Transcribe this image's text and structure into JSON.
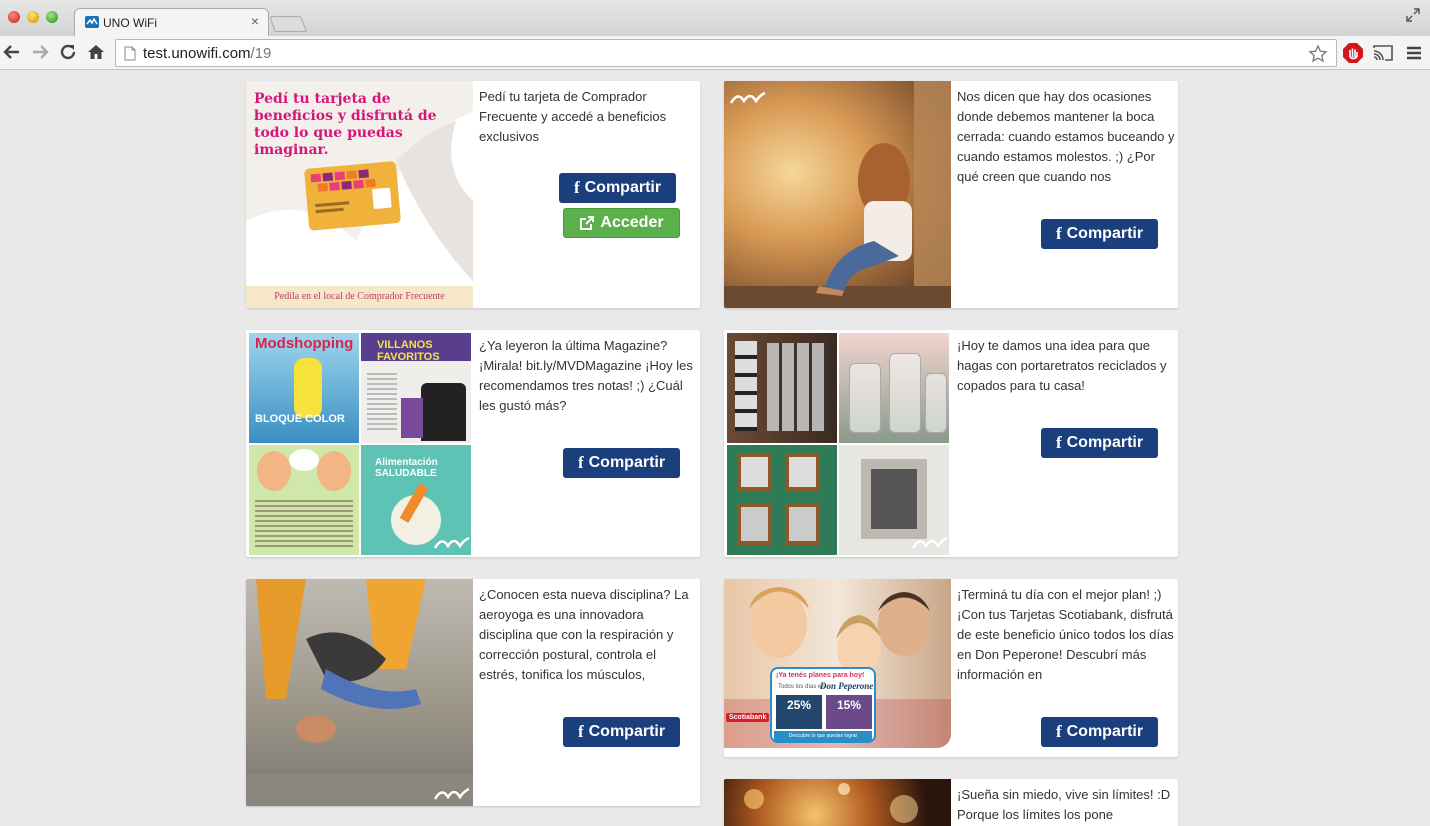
{
  "window": {
    "tab_title": "UNO WiFi",
    "tab_close": "×"
  },
  "toolbar": {
    "url_host": "test.unowifi.com",
    "url_path": "/19"
  },
  "buttons": {
    "share_label": "Compartir",
    "access_label": "Acceder",
    "fb_letter": "f"
  },
  "posts": [
    {
      "text": "Pedí tu tarjeta de Comprador Frecuente y accedé a beneficios exclusivos",
      "image_headline": "Pedí tu tarjeta de beneficios y disfrutá de todo lo que puedas imaginar.",
      "image_footer": "Pedila en el local de Comprador Frecuente"
    },
    {
      "text": "Nos dicen que hay dos ocasiones donde debemos mantener la boca cerrada: cuando estamos buceando y cuando estamos molestos. ;) ¿Por qué creen que cuando nos"
    },
    {
      "text": "¿Ya leyeron la última Magazine? ¡Mirala! bit.ly/MVDMagazine ¡Hoy les recomendamos tres notas! ;) ¿Cuál les gustó más?",
      "magazine_labels": [
        "Modshopping",
        "VILLANOS FAVORITOS",
        "BLOQUE COLOR",
        "Alimentación SALUDABLE"
      ]
    },
    {
      "text": "¡Hoy te damos una idea para que hagas con portaretratos reciclados y copados para tu casa!"
    },
    {
      "text": "¿Conocen esta nueva disciplina? La aeroyoga es una innovadora disciplina que con la respiración y corrección postural, controla el estrés, tonifica los músculos,"
    },
    {
      "text": "¡Terminá tu día con el mejor plan! ;) ¡Con tus Tarjetas Scotiabank, disfrutá de este beneficio único todos los días en Don Peperone! Descubrí más información en",
      "promo_headline": "¡Ya tenés planes para hoy!",
      "promo_sub": "Todos los días en",
      "promo_brand": "Don Peperone",
      "promo_discount_a": "25%",
      "promo_discount_b": "15%",
      "promo_bank": "Scotiabank",
      "promo_footer": "Descubre lo que puedes lograr"
    },
    {
      "text": "¡Sueña sin miedo, vive sin límites! :D Porque los límites los pone"
    }
  ],
  "colors": {
    "share_button": "#1a3f7c",
    "access_button": "#5cb04b",
    "page_background": "#e9e9e9"
  }
}
